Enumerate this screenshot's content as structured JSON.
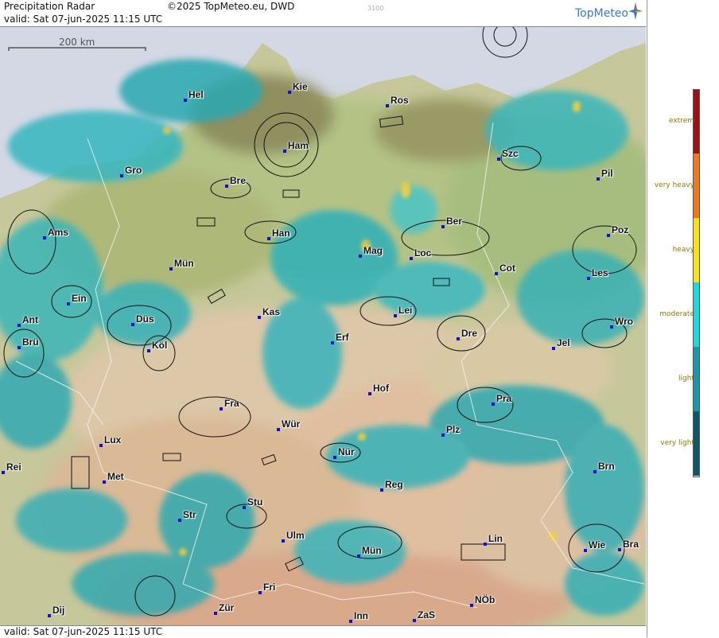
{
  "header": {
    "title": "Precipitation Radar",
    "copyright": "©2025 TopMeteo.eu, DWD",
    "valid": "valid:  Sat  07-jun-2025 11:15 UTC",
    "code": "3100",
    "brand": "TopMeteo"
  },
  "scale": {
    "label": "200 km"
  },
  "footer": {
    "valid": "valid:  Sat  07-jun-2025 11:15 UTC"
  },
  "legend": [
    {
      "label": "extrem",
      "color": "#a01010"
    },
    {
      "label": "very heavy",
      "color": "#f07820"
    },
    {
      "label": "heavy",
      "color": "#f8e020"
    },
    {
      "label": "moderate",
      "color": "#20d8d8"
    },
    {
      "label": "light",
      "color": "#1898a8"
    },
    {
      "label": "very light",
      "color": "#0c5868"
    }
  ],
  "cities": [
    {
      "name": "Kie"
    },
    {
      "name": "Hel"
    },
    {
      "name": "Ros"
    },
    {
      "name": "Ham"
    },
    {
      "name": "Szc"
    },
    {
      "name": "Gro"
    },
    {
      "name": "Bre"
    },
    {
      "name": "Pil"
    },
    {
      "name": "Ber"
    },
    {
      "name": "Ams"
    },
    {
      "name": "Han"
    },
    {
      "name": "Poz"
    },
    {
      "name": "Mag"
    },
    {
      "name": "Loc"
    },
    {
      "name": "Mün"
    },
    {
      "name": "Cot"
    },
    {
      "name": "Les"
    },
    {
      "name": "Ein"
    },
    {
      "name": "Kas"
    },
    {
      "name": "Lei"
    },
    {
      "name": "Ant"
    },
    {
      "name": "Düs"
    },
    {
      "name": "Wro"
    },
    {
      "name": "Dre"
    },
    {
      "name": "Erf"
    },
    {
      "name": "Brü"
    },
    {
      "name": "Köl"
    },
    {
      "name": "Jel"
    },
    {
      "name": "Hof"
    },
    {
      "name": "Fra"
    },
    {
      "name": "Pra"
    },
    {
      "name": "Wür"
    },
    {
      "name": "Lux"
    },
    {
      "name": "Plz"
    },
    {
      "name": "Nür"
    },
    {
      "name": "Rei"
    },
    {
      "name": "Met"
    },
    {
      "name": "Brn"
    },
    {
      "name": "Reg"
    },
    {
      "name": "Stu"
    },
    {
      "name": "Str"
    },
    {
      "name": "Ulm"
    },
    {
      "name": "Lin"
    },
    {
      "name": "Mün"
    },
    {
      "name": "Wie"
    },
    {
      "name": "Bra"
    },
    {
      "name": "Fri"
    },
    {
      "name": "NÖb"
    },
    {
      "name": "Dij"
    },
    {
      "name": "Zür"
    },
    {
      "name": "Inn"
    },
    {
      "name": "ZaS"
    }
  ]
}
